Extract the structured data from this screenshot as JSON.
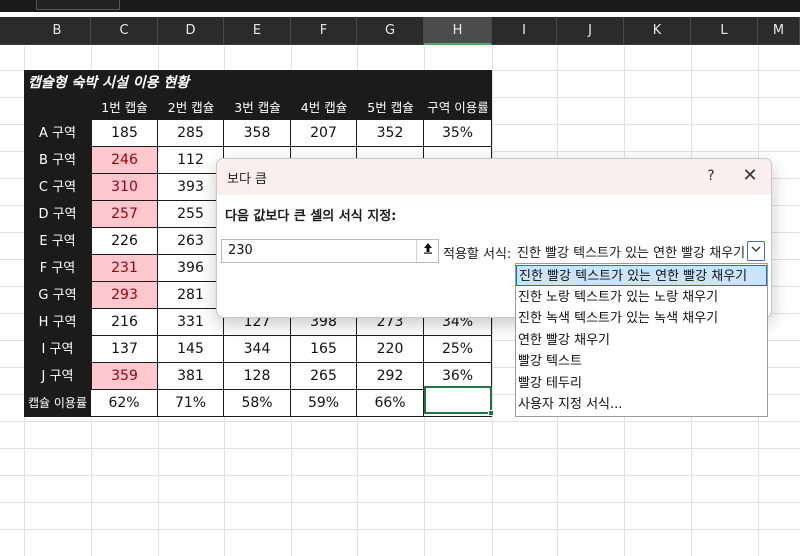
{
  "columns": [
    "B",
    "C",
    "D",
    "E",
    "F",
    "G",
    "H",
    "I",
    "J",
    "K",
    "L",
    "M"
  ],
  "selected_column": "H",
  "table": {
    "title": "캡슐형 숙박 시설 이용 현황",
    "headers": [
      "1번 캡슐",
      "2번 캡슐",
      "3번 캡슐",
      "4번 캡슐",
      "5번 캡슐",
      "구역 이용률"
    ],
    "rows": [
      {
        "label": "A 구역",
        "values": [
          "185",
          "285",
          "358",
          "207",
          "352",
          "35%"
        ],
        "highlight": [
          false,
          false,
          false,
          false,
          false,
          false
        ]
      },
      {
        "label": "B 구역",
        "values": [
          "246",
          "112",
          "",
          "",
          "",
          ""
        ],
        "highlight": [
          true,
          false,
          false,
          false,
          false,
          false
        ]
      },
      {
        "label": "C 구역",
        "values": [
          "310",
          "393",
          "",
          "",
          "",
          ""
        ],
        "highlight": [
          true,
          false,
          false,
          false,
          false,
          false
        ]
      },
      {
        "label": "D 구역",
        "values": [
          "257",
          "255",
          "",
          "",
          "",
          ""
        ],
        "highlight": [
          true,
          false,
          false,
          false,
          false,
          false
        ]
      },
      {
        "label": "E 구역",
        "values": [
          "226",
          "263",
          "",
          "",
          "",
          ""
        ],
        "highlight": [
          false,
          false,
          false,
          false,
          false,
          false
        ]
      },
      {
        "label": "F 구역",
        "values": [
          "231",
          "396",
          "",
          "",
          "",
          ""
        ],
        "highlight": [
          true,
          false,
          false,
          false,
          false,
          false
        ]
      },
      {
        "label": "G 구역",
        "values": [
          "293",
          "281",
          "",
          "",
          "",
          ""
        ],
        "highlight": [
          true,
          false,
          false,
          false,
          false,
          false
        ]
      },
      {
        "label": "H 구역",
        "values": [
          "216",
          "331",
          "127",
          "398",
          "273",
          "34%"
        ],
        "highlight": [
          false,
          false,
          false,
          false,
          false,
          false
        ]
      },
      {
        "label": "I 구역",
        "values": [
          "137",
          "145",
          "344",
          "165",
          "220",
          "25%"
        ],
        "highlight": [
          false,
          false,
          false,
          false,
          false,
          false
        ]
      },
      {
        "label": "J 구역",
        "values": [
          "359",
          "381",
          "128",
          "265",
          "292",
          "36%"
        ],
        "highlight": [
          true,
          false,
          false,
          false,
          false,
          false
        ]
      }
    ],
    "footer": {
      "label": "캡슐 이용률",
      "values": [
        "62%",
        "71%",
        "58%",
        "59%",
        "66%",
        ""
      ]
    }
  },
  "dialog": {
    "title": "보다 큼",
    "help": "?",
    "close": "✕",
    "prompt": "다음 값보다 큰 셀의 서식 지정:",
    "input_value": "230",
    "format_label": "적용할 서식:",
    "selected_format": "진한 빨강 텍스트가 있는 연한 빨강 채우기",
    "options": [
      "진한 빨강 텍스트가 있는 연한 빨강 채우기",
      "진한 노랑 텍스트가 있는 노랑 채우기",
      "진한 녹색 텍스트가 있는 녹색 채우기",
      "연한 빨강 채우기",
      "빨강 텍스트",
      "빨강 테두리",
      "사용자 지정 서식..."
    ]
  },
  "colors": {
    "highlight_fill": "#ffc7ce",
    "highlight_text": "#9c0006",
    "header_dark": "#1b1b1b",
    "selection": "#217346"
  },
  "icons": {
    "ref_button": "collapse-dialog-icon",
    "combo_arrow": "chevron-down-icon"
  }
}
